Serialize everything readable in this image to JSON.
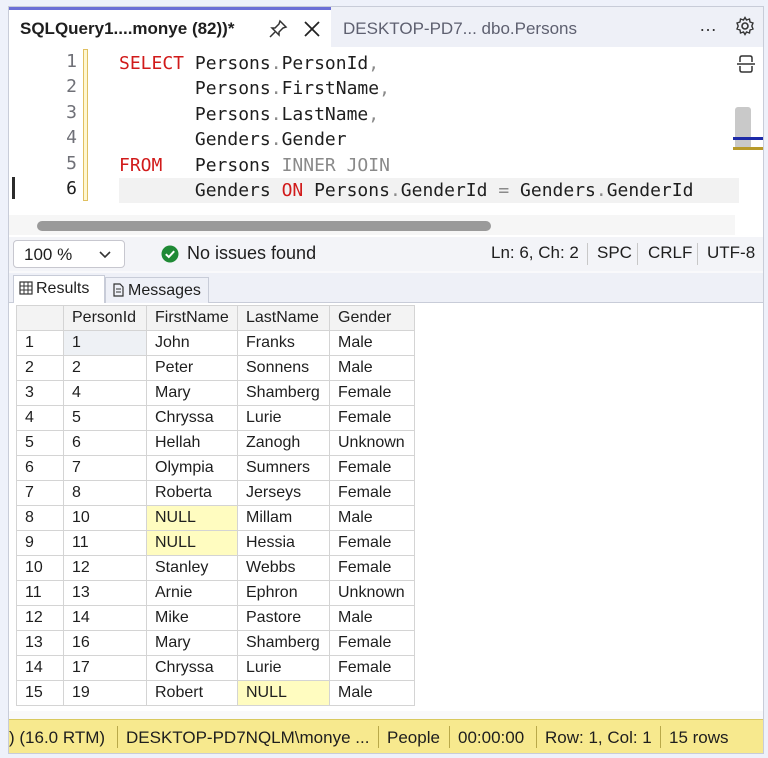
{
  "tabs": {
    "active_title": "SQLQuery1....monye (82))*",
    "inactive_title": "DESKTOP-PD7... dbo.Persons",
    "more_label": "…"
  },
  "editor": {
    "line_numbers": [
      "1",
      "2",
      "3",
      "4",
      "5",
      "6"
    ],
    "lines": [
      [
        {
          "t": "SELECT ",
          "c": "kw"
        },
        {
          "t": "Persons",
          "c": "ob"
        },
        {
          "t": ".",
          "c": "dim"
        },
        {
          "t": "PersonId",
          "c": "ob"
        },
        {
          "t": ",",
          "c": "dim"
        }
      ],
      [
        {
          "t": "       Persons",
          "c": "ob"
        },
        {
          "t": ".",
          "c": "dim"
        },
        {
          "t": "FirstName",
          "c": "ob"
        },
        {
          "t": ",",
          "c": "dim"
        }
      ],
      [
        {
          "t": "       Persons",
          "c": "ob"
        },
        {
          "t": ".",
          "c": "dim"
        },
        {
          "t": "LastName",
          "c": "ob"
        },
        {
          "t": ",",
          "c": "dim"
        }
      ],
      [
        {
          "t": "       Genders",
          "c": "ob"
        },
        {
          "t": ".",
          "c": "dim"
        },
        {
          "t": "Gender",
          "c": "ob"
        }
      ],
      [
        {
          "t": "FROM   ",
          "c": "kw"
        },
        {
          "t": "Persons ",
          "c": "ob"
        },
        {
          "t": "INNER JOIN",
          "c": "dim"
        }
      ],
      [
        {
          "t": "       Genders ",
          "c": "ob"
        },
        {
          "t": "ON ",
          "c": "kw"
        },
        {
          "t": "Persons",
          "c": "ob"
        },
        {
          "t": ".",
          "c": "dim"
        },
        {
          "t": "GenderId ",
          "c": "ob"
        },
        {
          "t": "= ",
          "c": "dim"
        },
        {
          "t": "Genders",
          "c": "ob"
        },
        {
          "t": ".",
          "c": "dim"
        },
        {
          "t": "GenderId",
          "c": "ob"
        }
      ]
    ],
    "current_line": 6
  },
  "editor_status": {
    "zoom": "100 %",
    "issues": "No issues found",
    "position": "Ln: 6, Ch: 2",
    "whitespace": "SPC",
    "line_endings": "CRLF",
    "encoding": "UTF-8"
  },
  "result_tabs": {
    "results": "Results",
    "messages": "Messages"
  },
  "grid": {
    "columns": [
      "PersonId",
      "FirstName",
      "LastName",
      "Gender"
    ],
    "rows": [
      [
        "1",
        "1",
        "John",
        "Franks",
        "Male"
      ],
      [
        "2",
        "2",
        "Peter",
        "Sonnens",
        "Male"
      ],
      [
        "3",
        "4",
        "Mary",
        "Shamberg",
        "Female"
      ],
      [
        "4",
        "5",
        "Chryssa",
        "Lurie",
        "Female"
      ],
      [
        "5",
        "6",
        "Hellah",
        "Zanogh",
        "Unknown"
      ],
      [
        "6",
        "7",
        "Olympia",
        "Sumners",
        "Female"
      ],
      [
        "7",
        "8",
        "Roberta",
        "Jerseys",
        "Female"
      ],
      [
        "8",
        "10",
        "NULL",
        "Millam",
        "Male"
      ],
      [
        "9",
        "11",
        "NULL",
        "Hessia",
        "Female"
      ],
      [
        "10",
        "12",
        "Stanley",
        "Webbs",
        "Female"
      ],
      [
        "11",
        "13",
        "Arnie",
        "Ephron",
        "Unknown"
      ],
      [
        "12",
        "14",
        "Mike",
        "Pastore",
        "Male"
      ],
      [
        "13",
        "16",
        "Mary",
        "Shamberg",
        "Female"
      ],
      [
        "14",
        "17",
        "Chryssa",
        "Lurie",
        "Female"
      ],
      [
        "15",
        "19",
        "Robert",
        "NULL",
        "Male"
      ]
    ]
  },
  "query_status": {
    "version": ") (16.0 RTM)",
    "connection": "DESKTOP-PD7NQLM\\monye ...",
    "database": "People",
    "elapsed": "00:00:00",
    "cursor": "Row: 1, Col: 1",
    "row_count": "15 rows"
  },
  "colors": {
    "keyword": "#d11a1a",
    "status_bar": "#f7e98e",
    "null_cell": "#fffcc0",
    "accent": "#6b6fd6"
  }
}
